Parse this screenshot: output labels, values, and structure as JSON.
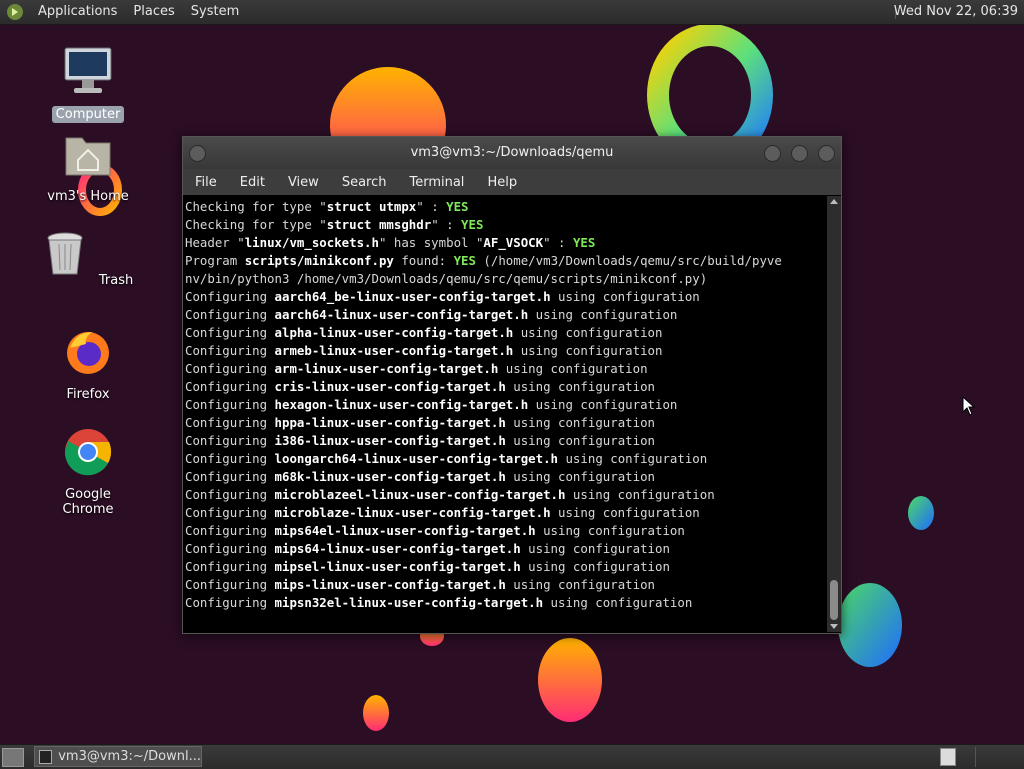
{
  "top_panel": {
    "menus": [
      "Applications",
      "Places",
      "System"
    ],
    "clock": "Wed Nov 22, 06:39"
  },
  "desktop_icons": [
    {
      "label": "Computer",
      "icon": "computer-icon"
    },
    {
      "label": "vm3's Home",
      "icon": "home-folder-icon"
    },
    {
      "label": "Trash",
      "icon": "trash-icon"
    },
    {
      "label": "Firefox",
      "icon": "firefox-icon"
    },
    {
      "label": "Google Chrome",
      "icon": "chrome-icon"
    }
  ],
  "terminal": {
    "title": "vm3@vm3:~/Downloads/qemu",
    "menu": [
      "File",
      "Edit",
      "View",
      "Search",
      "Terminal",
      "Help"
    ],
    "lines": [
      [
        {
          "t": "Checking for type \""
        },
        {
          "t": "struct utmpx",
          "b": 1
        },
        {
          "t": "\" : "
        },
        {
          "t": "YES",
          "y": 1
        }
      ],
      [
        {
          "t": "Checking for type \""
        },
        {
          "t": "struct mmsghdr",
          "b": 1
        },
        {
          "t": "\" : "
        },
        {
          "t": "YES",
          "y": 1
        }
      ],
      [
        {
          "t": "Header \""
        },
        {
          "t": "linux/vm_sockets.h",
          "b": 1
        },
        {
          "t": "\" has symbol \""
        },
        {
          "t": "AF_VSOCK",
          "b": 1
        },
        {
          "t": "\" : "
        },
        {
          "t": "YES",
          "y": 1
        }
      ],
      [
        {
          "t": "Program "
        },
        {
          "t": "scripts/minikconf.py",
          "b": 1
        },
        {
          "t": " found: "
        },
        {
          "t": "YES",
          "y": 1
        },
        {
          "t": " (/home/vm3/Downloads/qemu/src/build/pyve"
        }
      ],
      [
        {
          "t": "nv/bin/python3 /home/vm3/Downloads/qemu/src/qemu/scripts/minikconf.py)"
        }
      ],
      [
        {
          "t": "Configuring "
        },
        {
          "t": "aarch64_be-linux-user-config-target.h",
          "b": 1
        },
        {
          "t": " using configuration"
        }
      ],
      [
        {
          "t": "Configuring "
        },
        {
          "t": "aarch64-linux-user-config-target.h",
          "b": 1
        },
        {
          "t": " using configuration"
        }
      ],
      [
        {
          "t": "Configuring "
        },
        {
          "t": "alpha-linux-user-config-target.h",
          "b": 1
        },
        {
          "t": " using configuration"
        }
      ],
      [
        {
          "t": "Configuring "
        },
        {
          "t": "armeb-linux-user-config-target.h",
          "b": 1
        },
        {
          "t": " using configuration"
        }
      ],
      [
        {
          "t": "Configuring "
        },
        {
          "t": "arm-linux-user-config-target.h",
          "b": 1
        },
        {
          "t": " using configuration"
        }
      ],
      [
        {
          "t": "Configuring "
        },
        {
          "t": "cris-linux-user-config-target.h",
          "b": 1
        },
        {
          "t": " using configuration"
        }
      ],
      [
        {
          "t": "Configuring "
        },
        {
          "t": "hexagon-linux-user-config-target.h",
          "b": 1
        },
        {
          "t": " using configuration"
        }
      ],
      [
        {
          "t": "Configuring "
        },
        {
          "t": "hppa-linux-user-config-target.h",
          "b": 1
        },
        {
          "t": " using configuration"
        }
      ],
      [
        {
          "t": "Configuring "
        },
        {
          "t": "i386-linux-user-config-target.h",
          "b": 1
        },
        {
          "t": " using configuration"
        }
      ],
      [
        {
          "t": "Configuring "
        },
        {
          "t": "loongarch64-linux-user-config-target.h",
          "b": 1
        },
        {
          "t": " using configuration"
        }
      ],
      [
        {
          "t": "Configuring "
        },
        {
          "t": "m68k-linux-user-config-target.h",
          "b": 1
        },
        {
          "t": " using configuration"
        }
      ],
      [
        {
          "t": "Configuring "
        },
        {
          "t": "microblazeel-linux-user-config-target.h",
          "b": 1
        },
        {
          "t": " using configuration"
        }
      ],
      [
        {
          "t": "Configuring "
        },
        {
          "t": "microblaze-linux-user-config-target.h",
          "b": 1
        },
        {
          "t": " using configuration"
        }
      ],
      [
        {
          "t": "Configuring "
        },
        {
          "t": "mips64el-linux-user-config-target.h",
          "b": 1
        },
        {
          "t": " using configuration"
        }
      ],
      [
        {
          "t": "Configuring "
        },
        {
          "t": "mips64-linux-user-config-target.h",
          "b": 1
        },
        {
          "t": " using configuration"
        }
      ],
      [
        {
          "t": "Configuring "
        },
        {
          "t": "mipsel-linux-user-config-target.h",
          "b": 1
        },
        {
          "t": " using configuration"
        }
      ],
      [
        {
          "t": "Configuring "
        },
        {
          "t": "mips-linux-user-config-target.h",
          "b": 1
        },
        {
          "t": " using configuration"
        }
      ],
      [
        {
          "t": "Configuring "
        },
        {
          "t": "mipsn32el-linux-user-config-target.h",
          "b": 1
        },
        {
          "t": " using configuration"
        }
      ]
    ]
  },
  "taskbar": {
    "task_label": "vm3@vm3:~/Downl..."
  },
  "colors": {
    "desktop_bg": "#2b0d24",
    "terminal_bg": "#000000",
    "yes_green": "#7ee85a"
  }
}
